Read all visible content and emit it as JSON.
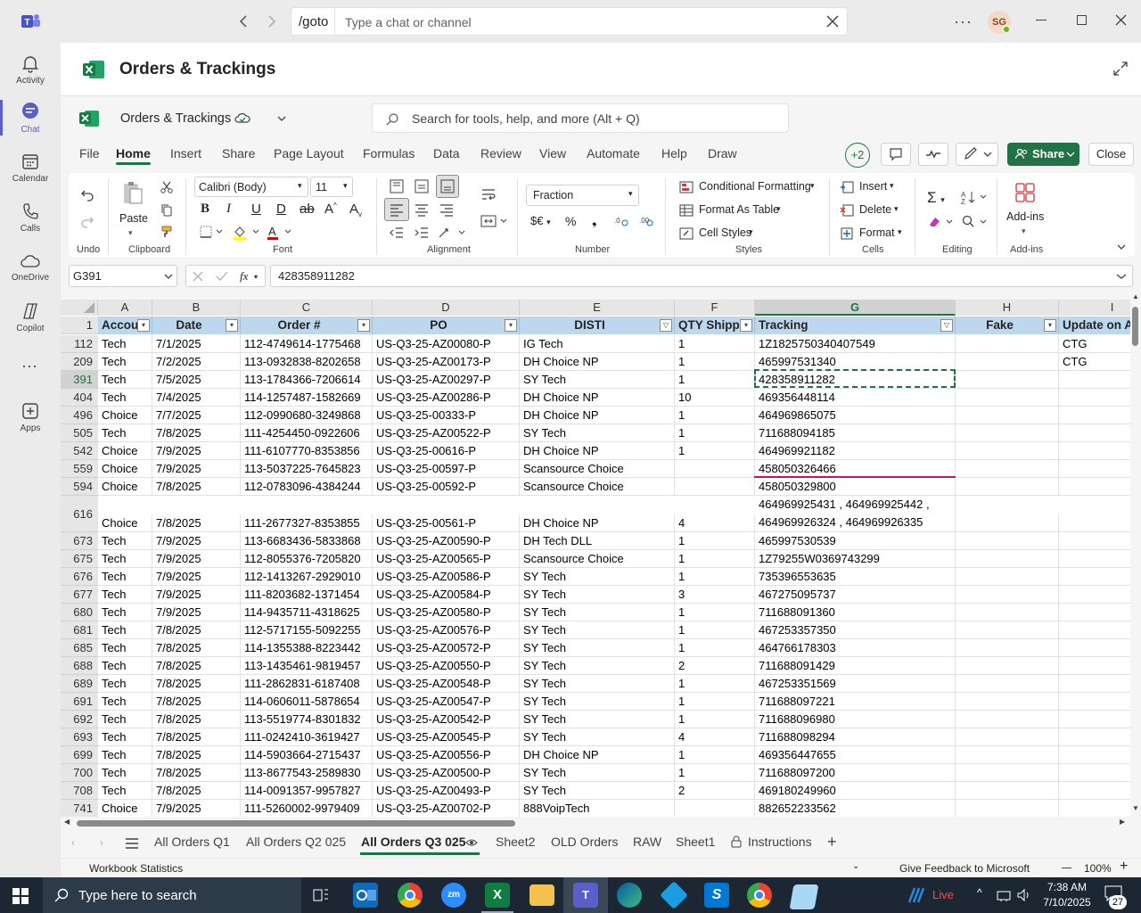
{
  "teams": {
    "goto": "/goto",
    "search_placeholder": "Type a chat or channel",
    "avatar": "SG",
    "rail": [
      {
        "label": "Activity",
        "icon": "bell-icon"
      },
      {
        "label": "Chat",
        "icon": "chat-icon"
      },
      {
        "label": "Calendar",
        "icon": "calendar-icon"
      },
      {
        "label": "Calls",
        "icon": "phone-icon"
      },
      {
        "label": "OneDrive",
        "icon": "cloud-icon"
      },
      {
        "label": "Copilot",
        "icon": "copilot-icon"
      },
      {
        "label": "Apps",
        "icon": "plus-box-icon"
      }
    ],
    "app_title": "Orders & Trackings"
  },
  "excel": {
    "workbook_name": "Orders & Trackings",
    "search_placeholder": "Search for tools, help, and more (Alt + Q)",
    "tabs": [
      "File",
      "Home",
      "Insert",
      "Share",
      "Page Layout",
      "Formulas",
      "Data",
      "Review",
      "View",
      "Automate",
      "Help",
      "Draw"
    ],
    "active_tab": "Home",
    "collab_count": "+2",
    "share_label": "Share",
    "close_label": "Close",
    "groups": {
      "undo": "Undo",
      "clipboard": "Clipboard",
      "font": "Font",
      "alignment": "Alignment",
      "number": "Number",
      "styles": "Styles",
      "cells": "Cells",
      "editing": "Editing",
      "addins": "Add-ins"
    },
    "paste_label": "Paste",
    "font_name": "Calibri (Body)",
    "font_size": "11",
    "number_format": "Fraction",
    "conditional_formatting": "Conditional Formatting",
    "format_as_table": "Format As Table",
    "cell_styles": "Cell Styles",
    "insert": "Insert",
    "delete": "Delete",
    "format": "Format",
    "addins_label": "Add-ins",
    "name_box": "G391",
    "formula_value": "428358911282",
    "columns": [
      "A",
      "B",
      "C",
      "D",
      "E",
      "F",
      "G",
      "H",
      "I"
    ],
    "selected_column": "G",
    "header_row_num": "1",
    "headers": [
      "Accou",
      "Date",
      "Order #",
      "PO",
      "DISTI",
      "QTY Shippe",
      "Tracking",
      "Fake",
      "Update on Ar"
    ],
    "rows": [
      {
        "n": "112",
        "a": "Tech",
        "b": "7/1/2025",
        "c": "112-4749614-1775468",
        "d": "US-Q3-25-AZ00080-P",
        "e": "IG Tech",
        "f": "1",
        "g": "1Z1825750340407549",
        "h": "",
        "i": "CTG"
      },
      {
        "n": "209",
        "a": "Tech",
        "b": "7/2/2025",
        "c": "113-0932838-8202658",
        "d": "US-Q3-25-AZ00173-P",
        "e": "DH Choice NP",
        "f": "1",
        "g": "465997531340",
        "h": "",
        "i": "CTG"
      },
      {
        "n": "391",
        "a": "Tech",
        "b": "7/5/2025",
        "c": "113-1784366-7206614",
        "d": "US-Q3-25-AZ00297-P",
        "e": "SY Tech",
        "f": "1",
        "g": "428358911282",
        "h": "",
        "i": ""
      },
      {
        "n": "404",
        "a": "Tech",
        "b": "7/4/2025",
        "c": "114-1257487-1582669",
        "d": "US-Q3-25-AZ00286-P",
        "e": "DH Choice NP",
        "f": "10",
        "g": "469356448114",
        "h": "",
        "i": ""
      },
      {
        "n": "496",
        "a": "Choice",
        "b": "7/7/2025",
        "c": "112-0990680-3249868",
        "d": "US-Q3-25-00333-P",
        "e": "DH Choice NP",
        "f": "1",
        "g": "464969865075",
        "h": "",
        "i": ""
      },
      {
        "n": "505",
        "a": "Tech",
        "b": "7/8/2025",
        "c": "111-4254450-0922606",
        "d": "US-Q3-25-AZ00522-P",
        "e": "SY Tech",
        "f": "1",
        "g": "711688094185",
        "h": "",
        "i": ""
      },
      {
        "n": "542",
        "a": "Choice",
        "b": "7/9/2025",
        "c": "111-6107770-8353856",
        "d": "US-Q3-25-00616-P",
        "e": "DH Choice NP",
        "f": "1",
        "g": "464969921182",
        "h": "",
        "i": ""
      },
      {
        "n": "559",
        "a": "Choice",
        "b": "7/9/2025",
        "c": "113-5037225-7645823",
        "d": "US-Q3-25-00597-P",
        "e": "Scansource Choice",
        "f": "",
        "g": "458050326466",
        "h": "",
        "i": ""
      },
      {
        "n": "594",
        "a": "Choice",
        "b": "7/8/2025",
        "c": "112-0783096-4384244",
        "d": "US-Q3-25-00592-P",
        "e": "Scansource Choice",
        "f": "",
        "g": "458050329800",
        "h": "",
        "i": ""
      },
      {
        "n": "616",
        "a": "Choice",
        "b": "7/8/2025",
        "c": "111-2677327-8353855",
        "d": "US-Q3-25-00561-P",
        "e": "DH Choice NP",
        "f": "4",
        "g": "464969925431 , 464969925442 ,",
        "g2": "464969926324 , 464969926335",
        "h": "",
        "i": ""
      },
      {
        "n": "673",
        "a": "Tech",
        "b": "7/9/2025",
        "c": "113-6683436-5833868",
        "d": "US-Q3-25-AZ00590-P",
        "e": "DH Tech DLL",
        "f": "1",
        "g": "465997530539",
        "h": "",
        "i": ""
      },
      {
        "n": "675",
        "a": "Tech",
        "b": "7/9/2025",
        "c": "112-8055376-7205820",
        "d": "US-Q3-25-AZ00565-P",
        "e": "Scansource Choice",
        "f": "1",
        "g": "1Z79255W0369743299",
        "h": "",
        "i": ""
      },
      {
        "n": "676",
        "a": "Tech",
        "b": "7/9/2025",
        "c": "112-1413267-2929010",
        "d": "US-Q3-25-AZ00586-P",
        "e": "SY Tech",
        "f": "1",
        "g": "735396553635",
        "h": "",
        "i": ""
      },
      {
        "n": "677",
        "a": "Tech",
        "b": "7/9/2025",
        "c": "111-8203682-1371454",
        "d": "US-Q3-25-AZ00584-P",
        "e": "SY Tech",
        "f": "3",
        "g": "467275095737",
        "h": "",
        "i": ""
      },
      {
        "n": "680",
        "a": "Tech",
        "b": "7/9/2025",
        "c": "114-9435711-4318625",
        "d": "US-Q3-25-AZ00580-P",
        "e": "SY Tech",
        "f": "1",
        "g": "711688091360",
        "h": "",
        "i": ""
      },
      {
        "n": "681",
        "a": "Tech",
        "b": "7/8/2025",
        "c": "112-5717155-5092255",
        "d": "US-Q3-25-AZ00576-P",
        "e": "SY Tech",
        "f": "1",
        "g": "467253357350",
        "h": "",
        "i": ""
      },
      {
        "n": "685",
        "a": "Tech",
        "b": "7/8/2025",
        "c": "114-1355388-8223442",
        "d": "US-Q3-25-AZ00572-P",
        "e": "SY Tech",
        "f": "1",
        "g": "464766178303",
        "h": "",
        "i": ""
      },
      {
        "n": "688",
        "a": "Tech",
        "b": "7/8/2025",
        "c": "113-1435461-9819457",
        "d": "US-Q3-25-AZ00550-P",
        "e": "SY Tech",
        "f": "2",
        "g": "711688091429",
        "h": "",
        "i": ""
      },
      {
        "n": "689",
        "a": "Tech",
        "b": "7/8/2025",
        "c": "111-2862831-6187408",
        "d": "US-Q3-25-AZ00548-P",
        "e": "SY Tech",
        "f": "1",
        "g": "467253351569",
        "h": "",
        "i": ""
      },
      {
        "n": "691",
        "a": "Tech",
        "b": "7/8/2025",
        "c": "114-0606011-5878654",
        "d": "US-Q3-25-AZ00547-P",
        "e": "SY Tech",
        "f": "1",
        "g": "711688097221",
        "h": "",
        "i": ""
      },
      {
        "n": "692",
        "a": "Tech",
        "b": "7/8/2025",
        "c": "113-5519774-8301832",
        "d": "US-Q3-25-AZ00542-P",
        "e": "SY Tech",
        "f": "1",
        "g": "711688096980",
        "h": "",
        "i": ""
      },
      {
        "n": "693",
        "a": "Tech",
        "b": "7/8/2025",
        "c": "111-0242410-3619427",
        "d": "US-Q3-25-AZ00545-P",
        "e": "SY Tech",
        "f": "4",
        "g": "711688098294",
        "h": "",
        "i": ""
      },
      {
        "n": "699",
        "a": "Tech",
        "b": "7/8/2025",
        "c": "114-5903664-2715437",
        "d": "US-Q3-25-AZ00556-P",
        "e": "DH Choice NP",
        "f": "1",
        "g": "469356447655",
        "h": "",
        "i": ""
      },
      {
        "n": "700",
        "a": "Tech",
        "b": "7/8/2025",
        "c": "113-8677543-2589830",
        "d": "US-Q3-25-AZ00500-P",
        "e": "SY Tech",
        "f": "1",
        "g": "711688097200",
        "h": "",
        "i": ""
      },
      {
        "n": "708",
        "a": "Tech",
        "b": "7/8/2025",
        "c": "114-0091357-9957827",
        "d": "US-Q3-25-AZ00493-P",
        "e": "SY Tech",
        "f": "2",
        "g": "469180249960",
        "h": "",
        "i": ""
      },
      {
        "n": "741",
        "a": "Choice",
        "b": "7/9/2025",
        "c": "111-5260002-9979409",
        "d": "US-Q3-25-AZ00702-P",
        "e": "888VoipTech",
        "f": "",
        "g": "882652233562",
        "h": "",
        "i": ""
      }
    ],
    "sheets": [
      "All Orders Q1",
      "All Orders Q2 025",
      "All Orders Q3 025",
      "Sheet2",
      "OLD Orders",
      "RAW",
      "Sheet1",
      "Instructions"
    ],
    "active_sheet": "All Orders Q3 025",
    "status_left": "Workbook Statistics",
    "feedback": "Give Feedback to Microsoft",
    "zoom": "100%"
  },
  "taskbar": {
    "search_placeholder": "Type here to search",
    "live": "Live",
    "time": "7:38 AM",
    "date": "7/10/2025",
    "notif_count": "27"
  },
  "colors": {
    "excel_green": "#217346",
    "teams_purple": "#5b5fc7",
    "header_fill": "#bdd7ee"
  }
}
